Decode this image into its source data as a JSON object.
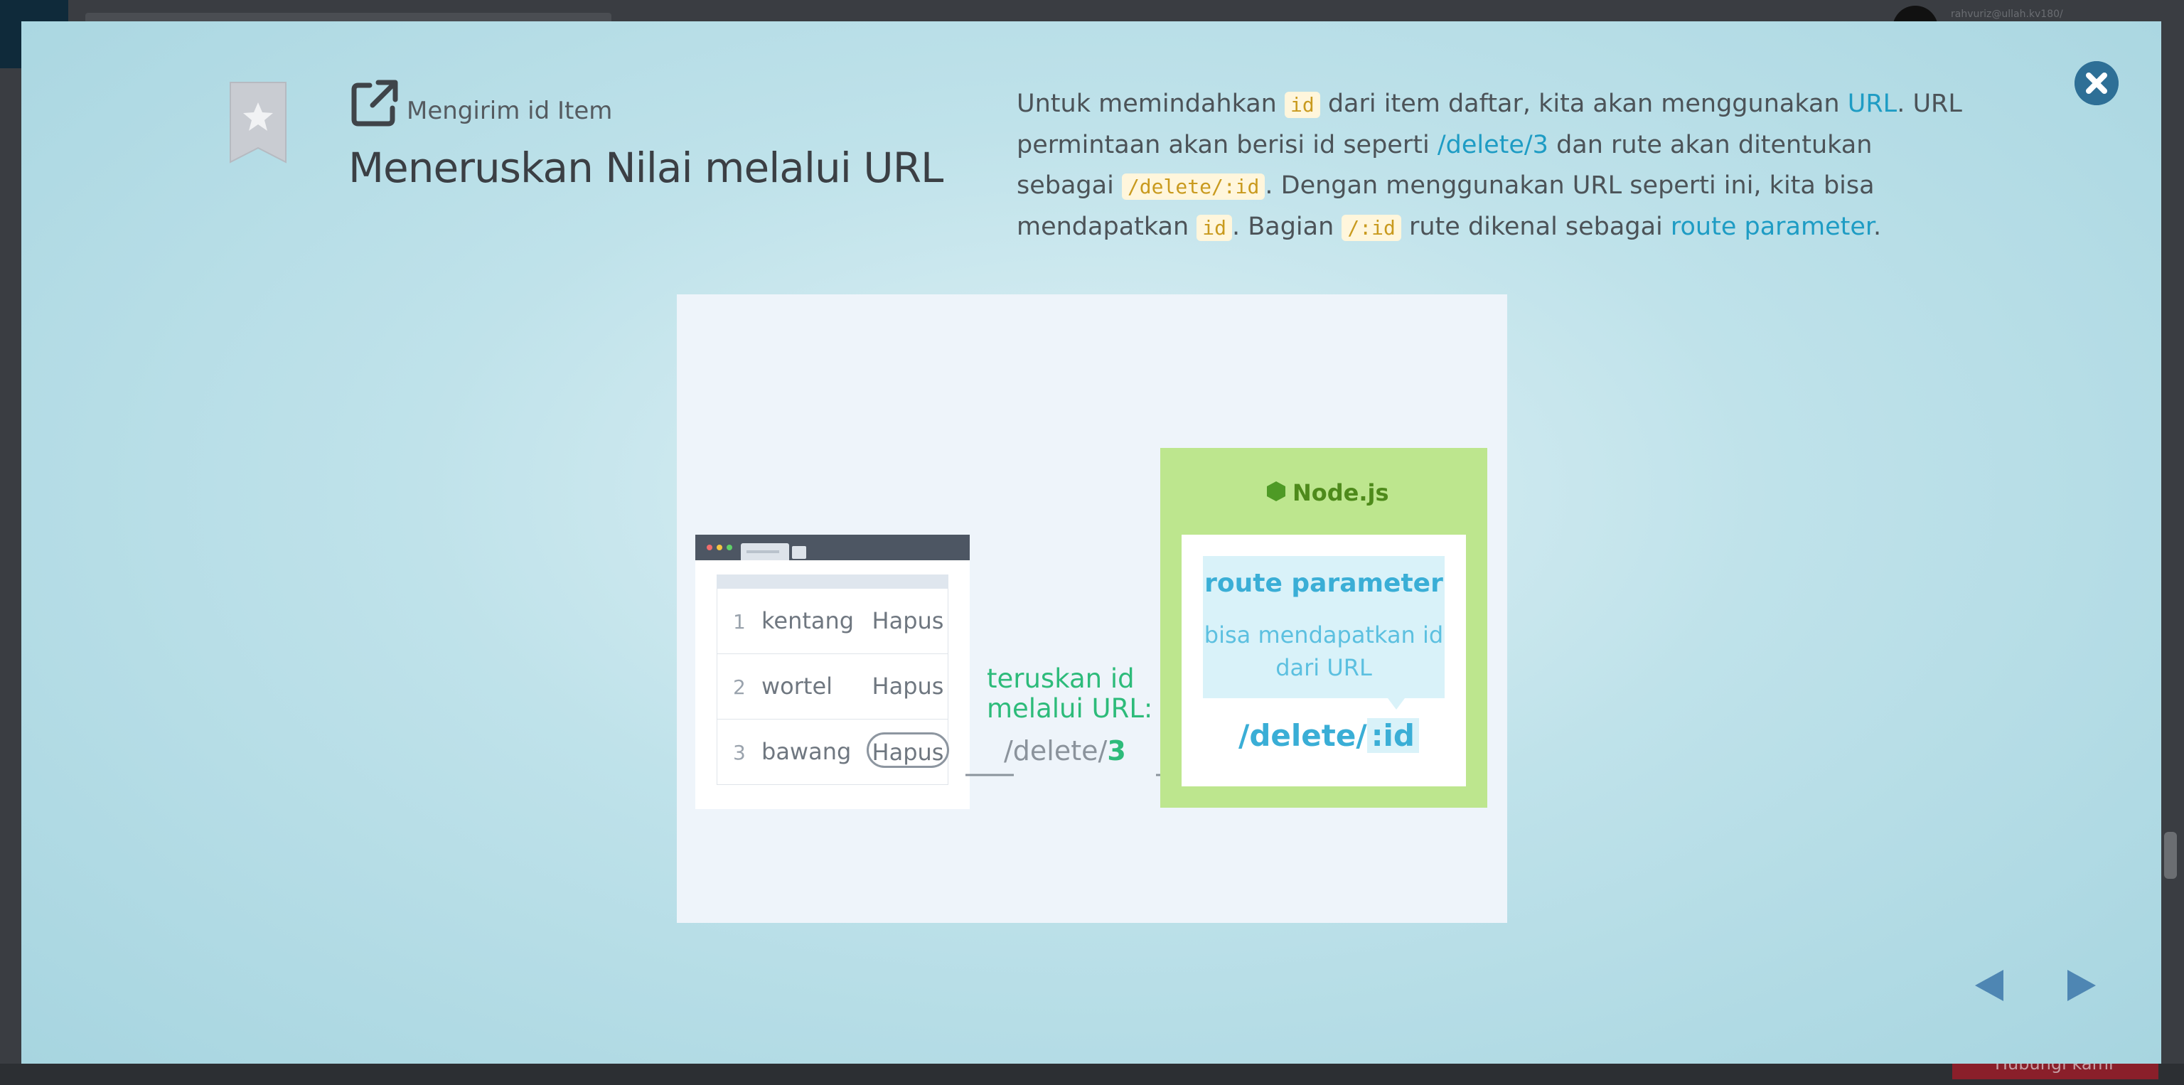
{
  "background": {
    "user_name": "rahvuriz@ullah.kv180/",
    "bottom_button": "Hubungi kami"
  },
  "modal": {
    "subtitle": "Mengirim id Item",
    "title": "Meneruskan Nilai melalui URL",
    "description": {
      "s1": "Untuk memindahkan ",
      "c_id": "id",
      "s2": " dari item daftar, kita akan menggunakan ",
      "link_url": "URL",
      "s3": ". URL permintaan akan berisi id seperti ",
      "link_delete3": "/delete/3",
      "s4": " dan rute akan ditentukan sebagai ",
      "c_route": "/delete/:id",
      "s5": ". Dengan menggunakan URL seperti ini, kita bisa mendapatkan ",
      "c_id2": "id",
      "s6": ". Bagian ",
      "c_colon_id": "/:id",
      "s7": " rute dikenal sebagai ",
      "link_route_param": "route parameter",
      "s8": "."
    }
  },
  "diagram": {
    "rows": [
      {
        "num": "1",
        "item": "kentang",
        "action": "Hapus"
      },
      {
        "num": "2",
        "item": "wortel",
        "action": "Hapus"
      },
      {
        "num": "3",
        "item": "bawang",
        "action": "Hapus"
      }
    ],
    "forward_label": "teruskan id melalui URL:",
    "url_prefix": "/delete/",
    "url_id": "3",
    "node_label": "Node.js",
    "rp_title": "route parameter",
    "rp_text": "bisa mendapatkan id dari URL",
    "route_prefix": "/delete/",
    "route_param": ":id"
  },
  "colors": {
    "accent": "#1e9cc4",
    "code": "#c99a1e",
    "node_green": "#bde68e",
    "forward_green": "#2dbb7a",
    "close": "#2e6f96"
  }
}
